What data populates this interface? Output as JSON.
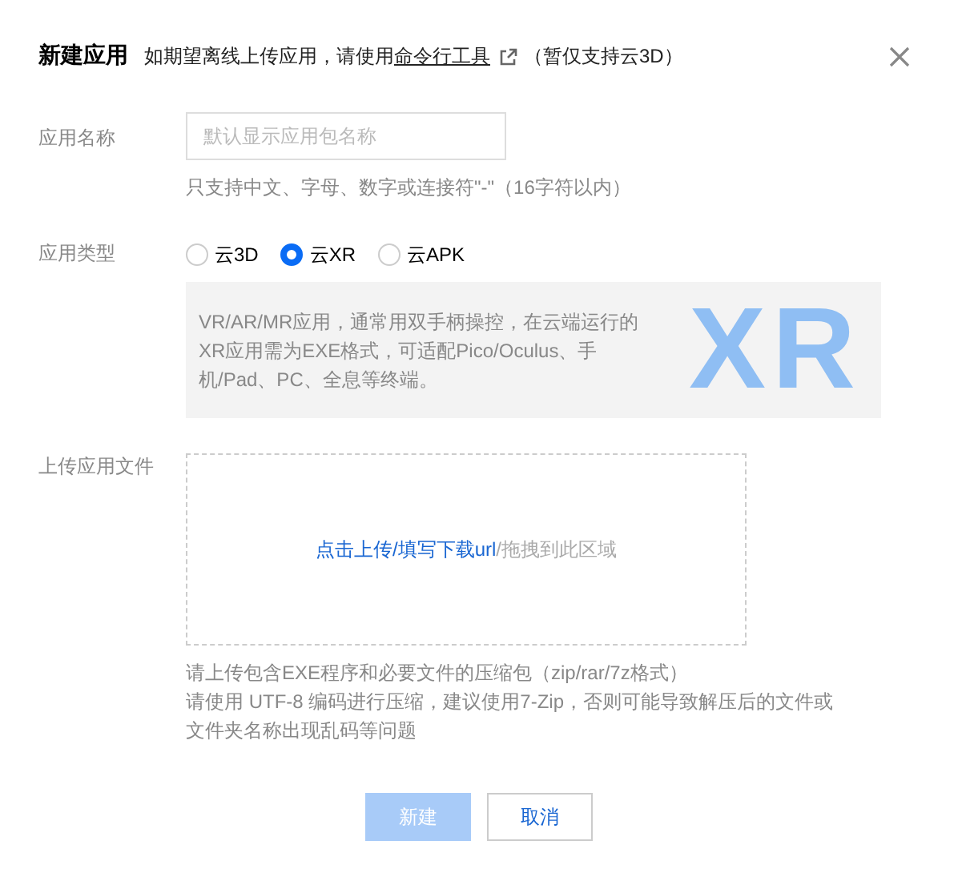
{
  "dialog": {
    "title": "新建应用",
    "subtitle_prefix": "如期望离线上传应用，请使用",
    "subtitle_link": "命令行工具",
    "subtitle_suffix": "（暂仅支持云3D）"
  },
  "name_field": {
    "label": "应用名称",
    "placeholder": "默认显示应用包名称",
    "hint": "只支持中文、字母、数字或连接符\"-\"（16字符以内）"
  },
  "type_field": {
    "label": "应用类型",
    "options": [
      {
        "label": "云3D",
        "selected": false
      },
      {
        "label": "云XR",
        "selected": true
      },
      {
        "label": "云APK",
        "selected": false
      }
    ],
    "description": "VR/AR/MR应用，通常用双手柄操控，在云端运行的XR应用需为EXE格式，可适配Pico/Oculus、手机/Pad、PC、全息等终端。",
    "watermark": "XR"
  },
  "upload_field": {
    "label": "上传应用文件",
    "link": "点击上传/填写下载url",
    "drop_text": "/拖拽到此区域",
    "notes": [
      "请上传包含EXE程序和必要文件的压缩包（zip/rar/7z格式）",
      "请使用 UTF-8 编码进行压缩，建议使用7-Zip，否则可能导致解压后的文件或文件夹名称出现乱码等问题"
    ]
  },
  "buttons": [
    {
      "label": "新建",
      "kind": "primary",
      "disabled": true
    },
    {
      "label": "取消",
      "kind": "secondary",
      "disabled": false
    }
  ]
}
